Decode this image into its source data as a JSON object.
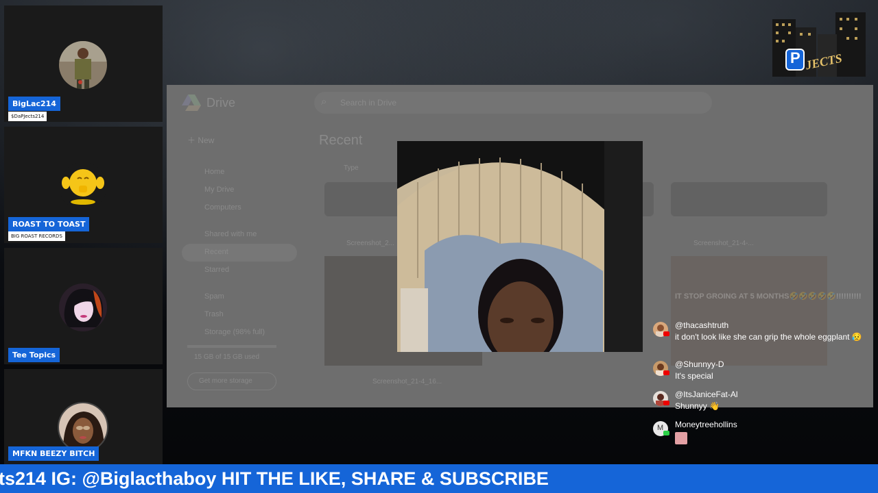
{
  "participants": [
    {
      "name": "BigLac214",
      "subtitle": "$DaPJects214"
    },
    {
      "name": "ROAST TO TOAST",
      "subtitle": "BIG ROAST RECORDS"
    },
    {
      "name": "Tee Topics",
      "subtitle": ""
    },
    {
      "name": "MFKN BEEZY BITCH",
      "subtitle": ""
    }
  ],
  "logo": {
    "letter": "P",
    "text": "JECTS",
    "icon": "city-building-logo"
  },
  "shared_screen": {
    "app": "Drive",
    "search_placeholder": "Search in Drive",
    "new_button": "New",
    "section_title": "Recent",
    "nav": [
      "Home",
      "My Drive",
      "Computers",
      "Shared with me",
      "Recent",
      "Starred",
      "Spam",
      "Trash",
      "Storage (98% full)"
    ],
    "storage_text": "15 GB of 15 GB used",
    "get_storage": "Get more storage",
    "files": [
      "Screenshot_2...",
      "Screenshot_21-4-...",
      "Screenshot_21-4_16..."
    ],
    "filter_chip": "Type"
  },
  "chat": {
    "fading_text": "IT STOP GROING AT 5 MONTHS🤣🤣🤣🤣🤣!!!!!!!!!!",
    "messages": [
      {
        "user": "@thacashtruth",
        "text": "it don't look like she can grip the whole eggplant 😥",
        "platform": "youtube"
      },
      {
        "user": "@Shunnyy-D",
        "text": "It's special",
        "platform": "youtube"
      },
      {
        "user": "@ItsJaniceFat-Al",
        "text": "Shunnyy 👋",
        "platform": "youtube"
      },
      {
        "user": "Moneytreehollins",
        "text": "",
        "platform": "kick",
        "initial": "M"
      }
    ]
  },
  "ticker": {
    "text": "ts214 IG: @Biglacthaboy HIT THE LIKE, SHARE & SUBSCRIBE"
  },
  "colors": {
    "accent": "#1565d8",
    "tile_bg": "#1a1a1a"
  }
}
